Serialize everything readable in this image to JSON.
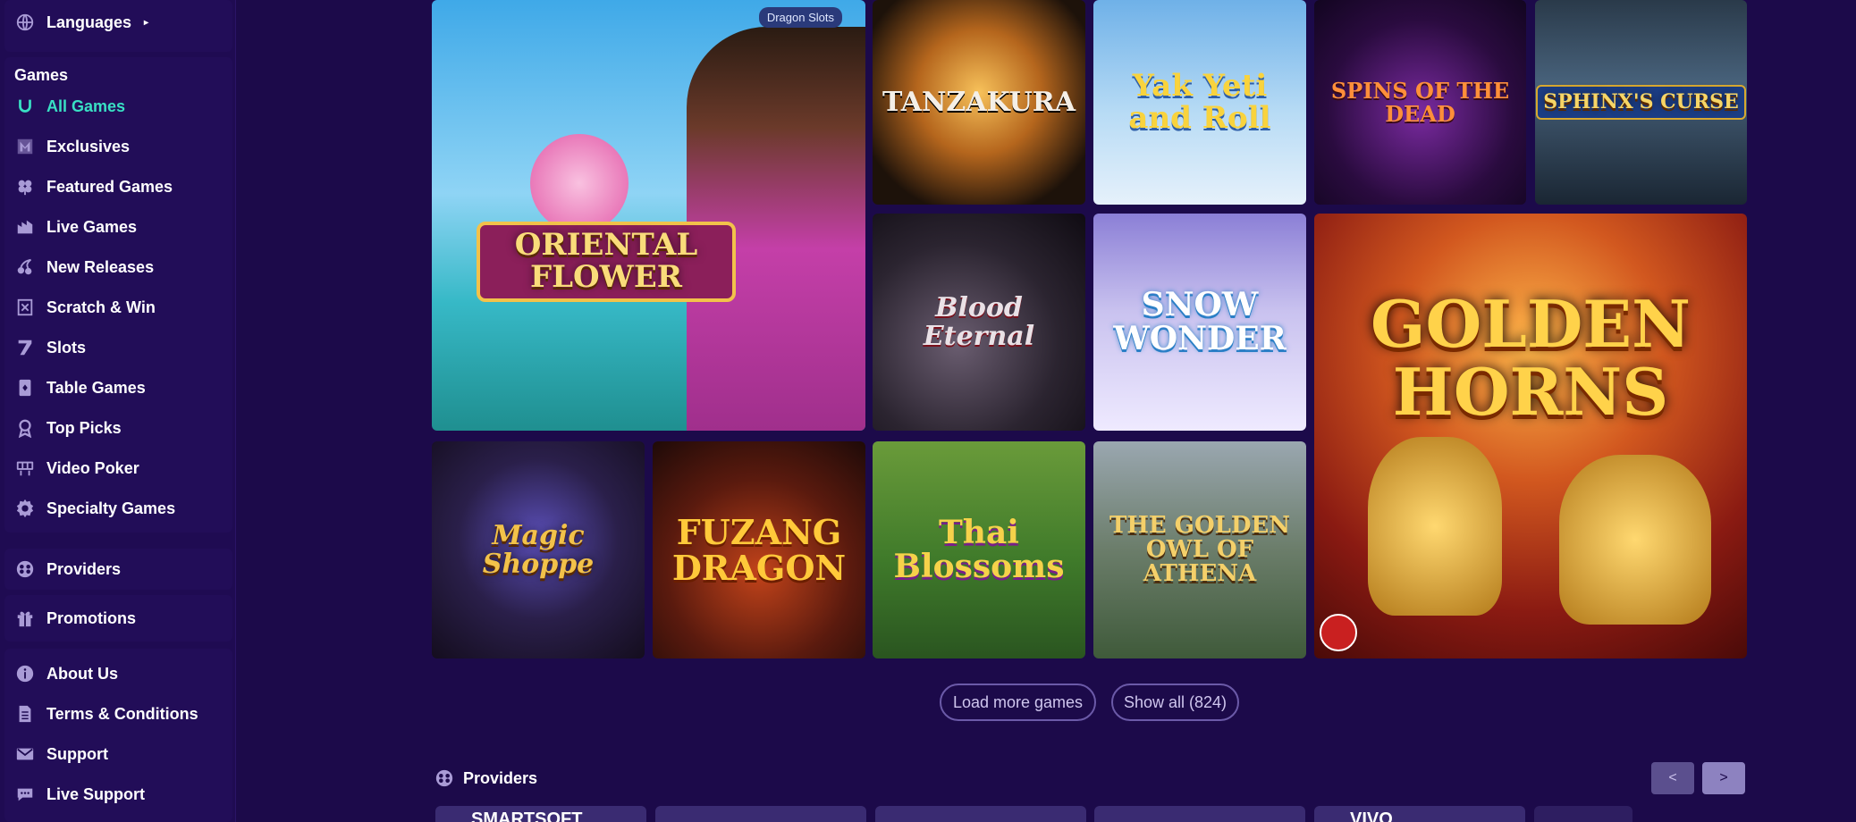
{
  "sidebar": {
    "languages_label": "Languages",
    "games_heading": "Games",
    "game_items": [
      {
        "label": "All Games",
        "icon": "horseshoe-icon"
      },
      {
        "label": "Exclusives",
        "icon": "exclusive-icon"
      },
      {
        "label": "Featured Games",
        "icon": "clover-icon"
      },
      {
        "label": "Live Games",
        "icon": "live-icon"
      },
      {
        "label": "New Releases",
        "icon": "cherries-icon"
      },
      {
        "label": "Scratch & Win",
        "icon": "scratch-card-icon"
      },
      {
        "label": "Slots",
        "icon": "seven-icon"
      },
      {
        "label": "Table Games",
        "icon": "playing-card-icon"
      },
      {
        "label": "Top Picks",
        "icon": "award-icon"
      },
      {
        "label": "Video Poker",
        "icon": "poker-machine-icon"
      },
      {
        "label": "Specialty Games",
        "icon": "gear-icon"
      }
    ],
    "providers_label": "Providers",
    "promotions_label": "Promotions",
    "info_items": [
      {
        "label": "About Us",
        "icon": "info-icon"
      },
      {
        "label": "Terms & Conditions",
        "icon": "document-icon"
      },
      {
        "label": "Support",
        "icon": "mail-icon"
      },
      {
        "label": "Live Support",
        "icon": "chat-icon"
      }
    ]
  },
  "games": {
    "badge": "Dragon Slots",
    "tiles": [
      {
        "title": "ORIENTAL FLOWER"
      },
      {
        "title": "TANZAKURA"
      },
      {
        "title": "Yak Yeti and Roll"
      },
      {
        "title": "SPINS OF THE DEAD"
      },
      {
        "title": "SPHINX'S CURSE"
      },
      {
        "title": "Blood Eternal"
      },
      {
        "title": "SNOW WONDER"
      },
      {
        "title": "GOLDEN HORNS"
      },
      {
        "title": "Magic Shoppe"
      },
      {
        "title": "FUZANG DRAGON"
      },
      {
        "title": "Thai Blossoms"
      },
      {
        "title": "THE GOLDEN OWL OF ATHENA"
      }
    ]
  },
  "actions": {
    "load_more": "Load more games",
    "show_all": "Show all (824)"
  },
  "providers": {
    "title": "Providers",
    "prev": "<",
    "next": ">",
    "cards": [
      "SMARTSOFT",
      "",
      "",
      "",
      "VIVO"
    ]
  },
  "colors": {
    "background": "#1c0a4a",
    "sidebar": "#1f0b52",
    "accent": "#39e0c4"
  }
}
